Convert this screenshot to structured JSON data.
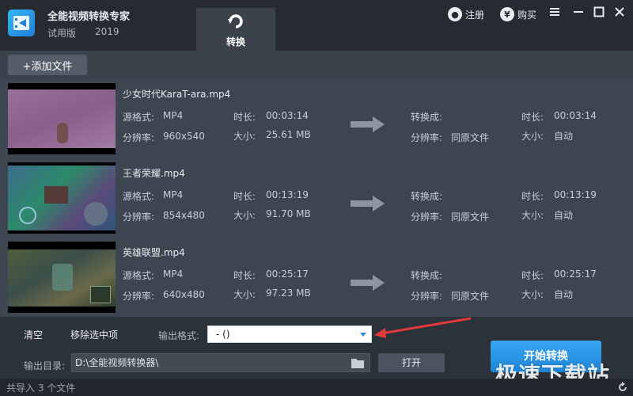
{
  "app": {
    "name": "全能视频转换专家",
    "edition": "试用版",
    "year": "2019",
    "logo_icon": "film-logo-icon"
  },
  "tabs": [
    {
      "label": "转换",
      "icon": "convert-arrow-icon"
    }
  ],
  "titlebar": {
    "register_label": "注册",
    "register_icon": "user-icon",
    "buy_label": "购买",
    "buy_icon": "yen-icon"
  },
  "toolbar": {
    "add_file_label": "+添加文件"
  },
  "labels": {
    "src_format": "源格式:",
    "resolution": "分辨率:",
    "duration": "时长:",
    "size": "大小:",
    "status": "转换成:"
  },
  "files": [
    {
      "name": "少女时代KaraT-ara.mp4",
      "format": "MP4",
      "resolution": "960x540",
      "duration": "00:03:14",
      "size": "25.61 MB",
      "out_duration": "00:03:14",
      "out_resolution": "同原文件",
      "out_size": "自动"
    },
    {
      "name": "王者荣耀.mp4",
      "format": "MP4",
      "resolution": "854x480",
      "duration": "00:13:19",
      "size": "91.70 MB",
      "out_duration": "00:13:19",
      "out_resolution": "同原文件",
      "out_size": "自动"
    },
    {
      "name": "英雄联盟.mp4",
      "format": "MP4",
      "resolution": "640x480",
      "duration": "00:25:17",
      "size": "97.23 MB",
      "out_duration": "00:25:17",
      "out_resolution": "同原文件",
      "out_size": "自动"
    }
  ],
  "bottom": {
    "clear_label": "清空",
    "remove_label": "移除选中项",
    "format_label": "输出格式:",
    "format_value": "- ()",
    "dir_label": "输出目录:",
    "dir_value": "D:\\全能视频转换器\\",
    "open_label": "打开",
    "start_label": "开始转换"
  },
  "status": {
    "text": "共导入 3 个文件"
  },
  "watermark": "极速下载站",
  "colors": {
    "accent": "#2e8fd8",
    "background": "#2c323a",
    "panel": "#3d4550"
  }
}
